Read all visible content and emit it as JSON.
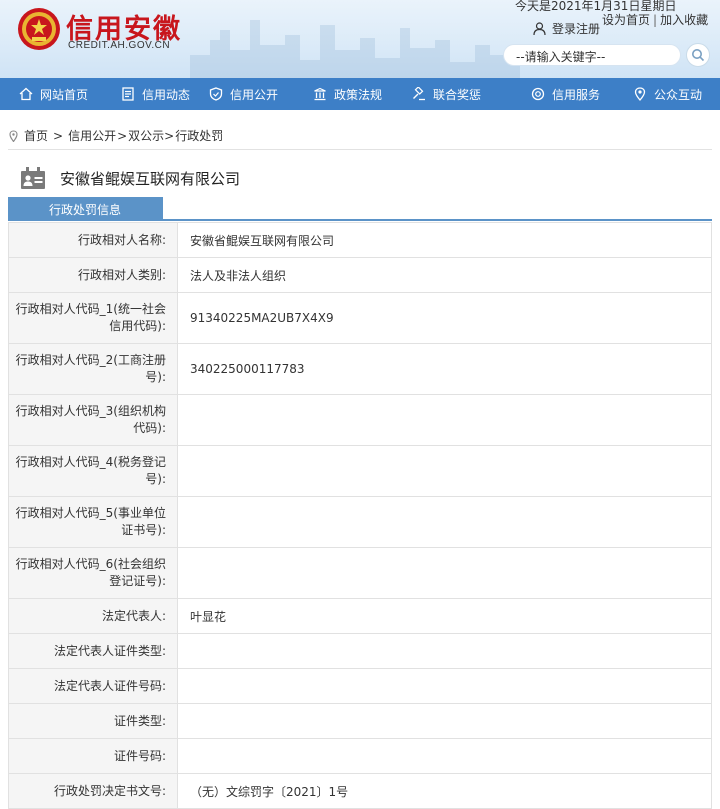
{
  "header": {
    "brand": "信用安徽",
    "brand_sub": "CREDIT.AH.GOV.CN",
    "date": "今天是2021年1月31日星期日",
    "set_home": "设为首页",
    "separator": "|",
    "add_favorite": "加入收藏",
    "login": "登录注册",
    "search_text": "--请输入关键字--"
  },
  "nav": {
    "items": [
      {
        "label": "网站首页",
        "icon": "home-icon"
      },
      {
        "label": "信用动态",
        "icon": "news-icon"
      },
      {
        "label": "信用公开",
        "icon": "shield-icon"
      },
      {
        "label": "政策法规",
        "icon": "policy-icon"
      },
      {
        "label": "联合奖惩",
        "icon": "gavel-icon"
      },
      {
        "label": "信用服务",
        "icon": "service-icon"
      },
      {
        "label": "公众互动",
        "icon": "location-icon"
      }
    ]
  },
  "breadcrumb": {
    "items": [
      "首页",
      "信用公开",
      "双公示",
      "行政处罚"
    ],
    "sep": ">"
  },
  "company": {
    "name": "安徽省鲲娱互联网有限公司"
  },
  "tab": {
    "label": "行政处罚信息"
  },
  "table": {
    "rows": [
      {
        "key": "行政相对人名称:",
        "value": "安徽省鲲娱互联网有限公司"
      },
      {
        "key": "行政相对人类别:",
        "value": "法人及非法人组织"
      },
      {
        "key": "行政相对人代码_1(统一社会信用代码):",
        "value": "91340225MA2UB7X4X9"
      },
      {
        "key": "行政相对人代码_2(工商注册号):",
        "value": "340225000117783"
      },
      {
        "key": "行政相对人代码_3(组织机构代码):",
        "value": ""
      },
      {
        "key": "行政相对人代码_4(税务登记号):",
        "value": ""
      },
      {
        "key": "行政相对人代码_5(事业单位证书号):",
        "value": ""
      },
      {
        "key": "行政相对人代码_6(社会组织登记证号):",
        "value": ""
      },
      {
        "key": "法定代表人:",
        "value": "叶显花"
      },
      {
        "key": "法定代表人证件类型:",
        "value": ""
      },
      {
        "key": "法定代表人证件号码:",
        "value": ""
      },
      {
        "key": "证件类型:",
        "value": ""
      },
      {
        "key": "证件号码:",
        "value": ""
      },
      {
        "key": "行政处罚决定书文号:",
        "value": "（无）文综罚字〔2021〕1号"
      }
    ]
  }
}
